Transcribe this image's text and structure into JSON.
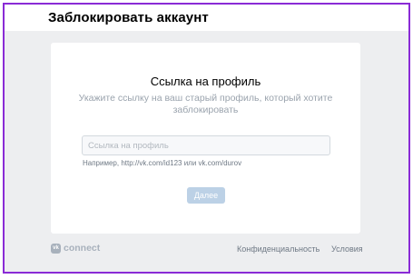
{
  "header": {
    "title": "Заблокировать аккаунт"
  },
  "card": {
    "title": "Ссылка на профиль",
    "subtitle": "Укажите ссылку на ваш старый профиль, который хотите заблокировать",
    "input_placeholder": "Ссылка на профиль",
    "input_value": "",
    "hint": "Например, http://vk.com/id123 или vk.com/durov",
    "next_label": "Далее"
  },
  "footer": {
    "logo_glyph": "vk",
    "brand": "connect",
    "privacy_label": "Конфиденциальность",
    "terms_label": "Условия"
  },
  "colors": {
    "frame_border": "#8a2bd6",
    "background": "#edeef0",
    "button_disabled": "#bcd1e6"
  }
}
